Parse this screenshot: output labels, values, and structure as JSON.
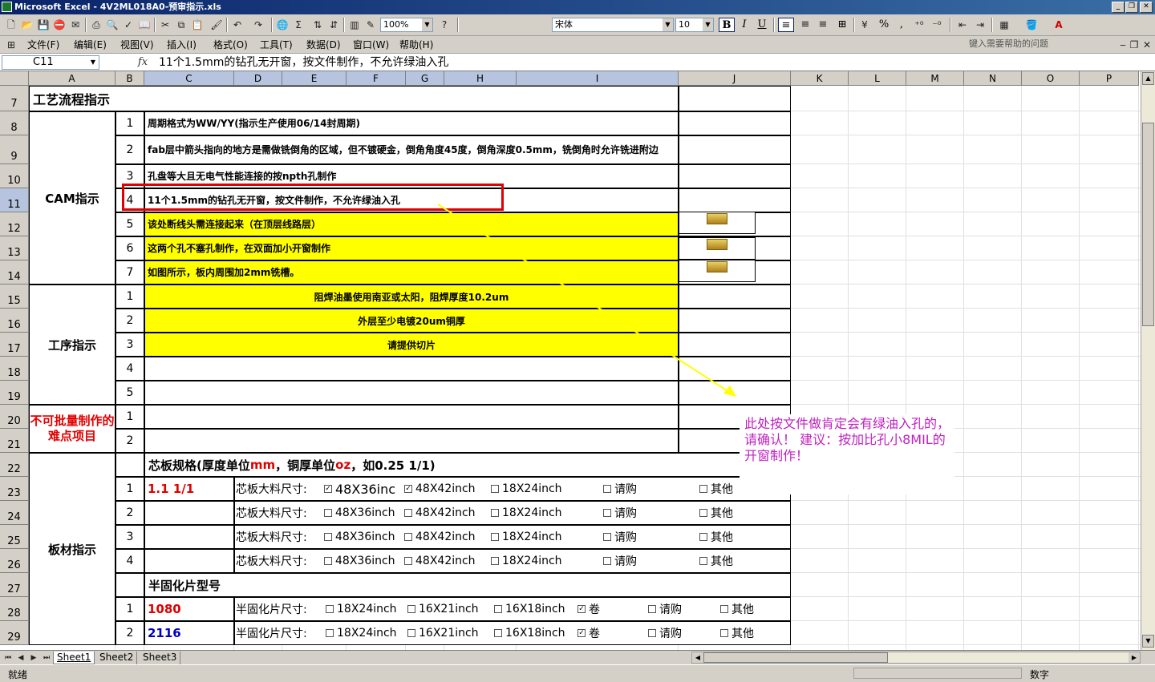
{
  "window": {
    "title": "Microsoft Excel - 4V2ML018A0-预审指示.xls"
  },
  "toolbar": {
    "zoom": "100%",
    "font": "宋体",
    "size": "10",
    "bold": "B",
    "italic": "I",
    "underline": "U",
    "percent": "%",
    "comma": ","
  },
  "menu": {
    "items": [
      "文件(F)",
      "编辑(E)",
      "视图(V)",
      "插入(I)",
      "格式(O)",
      "工具(T)",
      "数据(D)",
      "窗口(W)",
      "帮助(H)"
    ],
    "help_placeholder": "键入需要帮助的问题"
  },
  "formula": {
    "cell_ref": "C11",
    "fx": "fx",
    "content": "11个1.5mm的钻孔无开窗，按文件制作，不允许绿油入孔"
  },
  "columns": [
    "A",
    "B",
    "C",
    "D",
    "E",
    "F",
    "G",
    "H",
    "I",
    "J",
    "K",
    "L",
    "M",
    "N",
    "O",
    "P"
  ],
  "rows": [
    "7",
    "8",
    "9",
    "10",
    "11",
    "12",
    "13",
    "14",
    "15",
    "16",
    "17",
    "18",
    "19",
    "20",
    "21",
    "22",
    "23",
    "24",
    "25",
    "26",
    "27",
    "28",
    "29"
  ],
  "sheet": {
    "header": "工艺流程指示",
    "cam": {
      "label": "CAM指示",
      "items": [
        {
          "n": "1",
          "text": "周期格式为WW/YY(指示生产使用06/14封周期)"
        },
        {
          "n": "2",
          "text": "fab层中箭头指向的地方是需做铣倒角的区域，但不镀硬金，倒角角度45度，倒角深度0.5mm，铣倒角时允许铣进附边"
        },
        {
          "n": "3",
          "text": "孔盘等大且无电气性能连接的按npth孔制作"
        },
        {
          "n": "4",
          "text": "11个1.5mm的钻孔无开窗，按文件制作，不允许绿油入孔"
        },
        {
          "n": "5",
          "text": "该处断线头需连接起来（在顶层线路层）"
        },
        {
          "n": "6",
          "text": "这两个孔不塞孔制作，在双面加小开窗制作"
        },
        {
          "n": "7",
          "text": "如图所示，板内周围加2mm铣槽。"
        }
      ]
    },
    "process": {
      "label": "工序指示",
      "items": [
        {
          "n": "1",
          "text": "阻焊油墨使用南亚或太阳，阻焊厚度10.2um"
        },
        {
          "n": "2",
          "text": "外层至少电镀20um铜厚"
        },
        {
          "n": "3",
          "text": "请提供切片"
        },
        {
          "n": "4",
          "text": ""
        },
        {
          "n": "5",
          "text": ""
        }
      ]
    },
    "difficult": {
      "label": "不可批量制作的难点项目",
      "items": [
        "1",
        "2"
      ]
    },
    "material": {
      "label": "板材指示",
      "core_title_a": "芯板规格(厚度单位",
      "core_title_mm": "mm",
      "core_title_b": "，铜厚单位",
      "core_title_oz": "oz",
      "core_title_c": "，如0.25 1/1)",
      "core_label": "芯板大料尺寸:",
      "core_rows": [
        {
          "n": "1",
          "spec": "1.1 1/1",
          "opts": [
            "48X36inc",
            "48X42inch",
            "18X24inch",
            "请购",
            "其他"
          ],
          "checked": [
            true,
            true,
            false,
            false,
            false
          ]
        },
        {
          "n": "2",
          "spec": "",
          "opts": [
            "48X36inch",
            "48X42inch",
            "18X24inch",
            "请购",
            "其他"
          ],
          "checked": [
            false,
            false,
            false,
            false,
            false
          ]
        },
        {
          "n": "3",
          "spec": "",
          "opts": [
            "48X36inch",
            "48X42inch",
            "18X24inch",
            "请购",
            "其他"
          ],
          "checked": [
            false,
            false,
            false,
            false,
            false
          ]
        },
        {
          "n": "4",
          "spec": "",
          "opts": [
            "48X36inch",
            "48X42inch",
            "18X24inch",
            "请购",
            "其他"
          ],
          "checked": [
            false,
            false,
            false,
            false,
            false
          ]
        }
      ],
      "pp_title": "半固化片型号",
      "pp_label": "半固化片尺寸:",
      "pp_rows": [
        {
          "n": "1",
          "spec": "1080",
          "opts": [
            "18X24inch",
            "16X21inch",
            "16X18inch",
            "卷",
            "请购",
            "其他"
          ],
          "checked": [
            false,
            false,
            false,
            true,
            false,
            false
          ]
        },
        {
          "n": "2",
          "spec": "2116",
          "opts": [
            "18X24inch",
            "16X21inch",
            "16X18inch",
            "卷",
            "请购",
            "其他"
          ],
          "checked": [
            false,
            false,
            false,
            true,
            false,
            false
          ]
        }
      ]
    }
  },
  "comment": "此处按文件做肯定会有绿油入孔的，请确认！ 建议：按加比孔小8MIL的开窗制作！",
  "tabs": [
    "Sheet1",
    "Sheet2",
    "Sheet3"
  ],
  "status": {
    "ready": "就绪",
    "mode": "数字"
  }
}
